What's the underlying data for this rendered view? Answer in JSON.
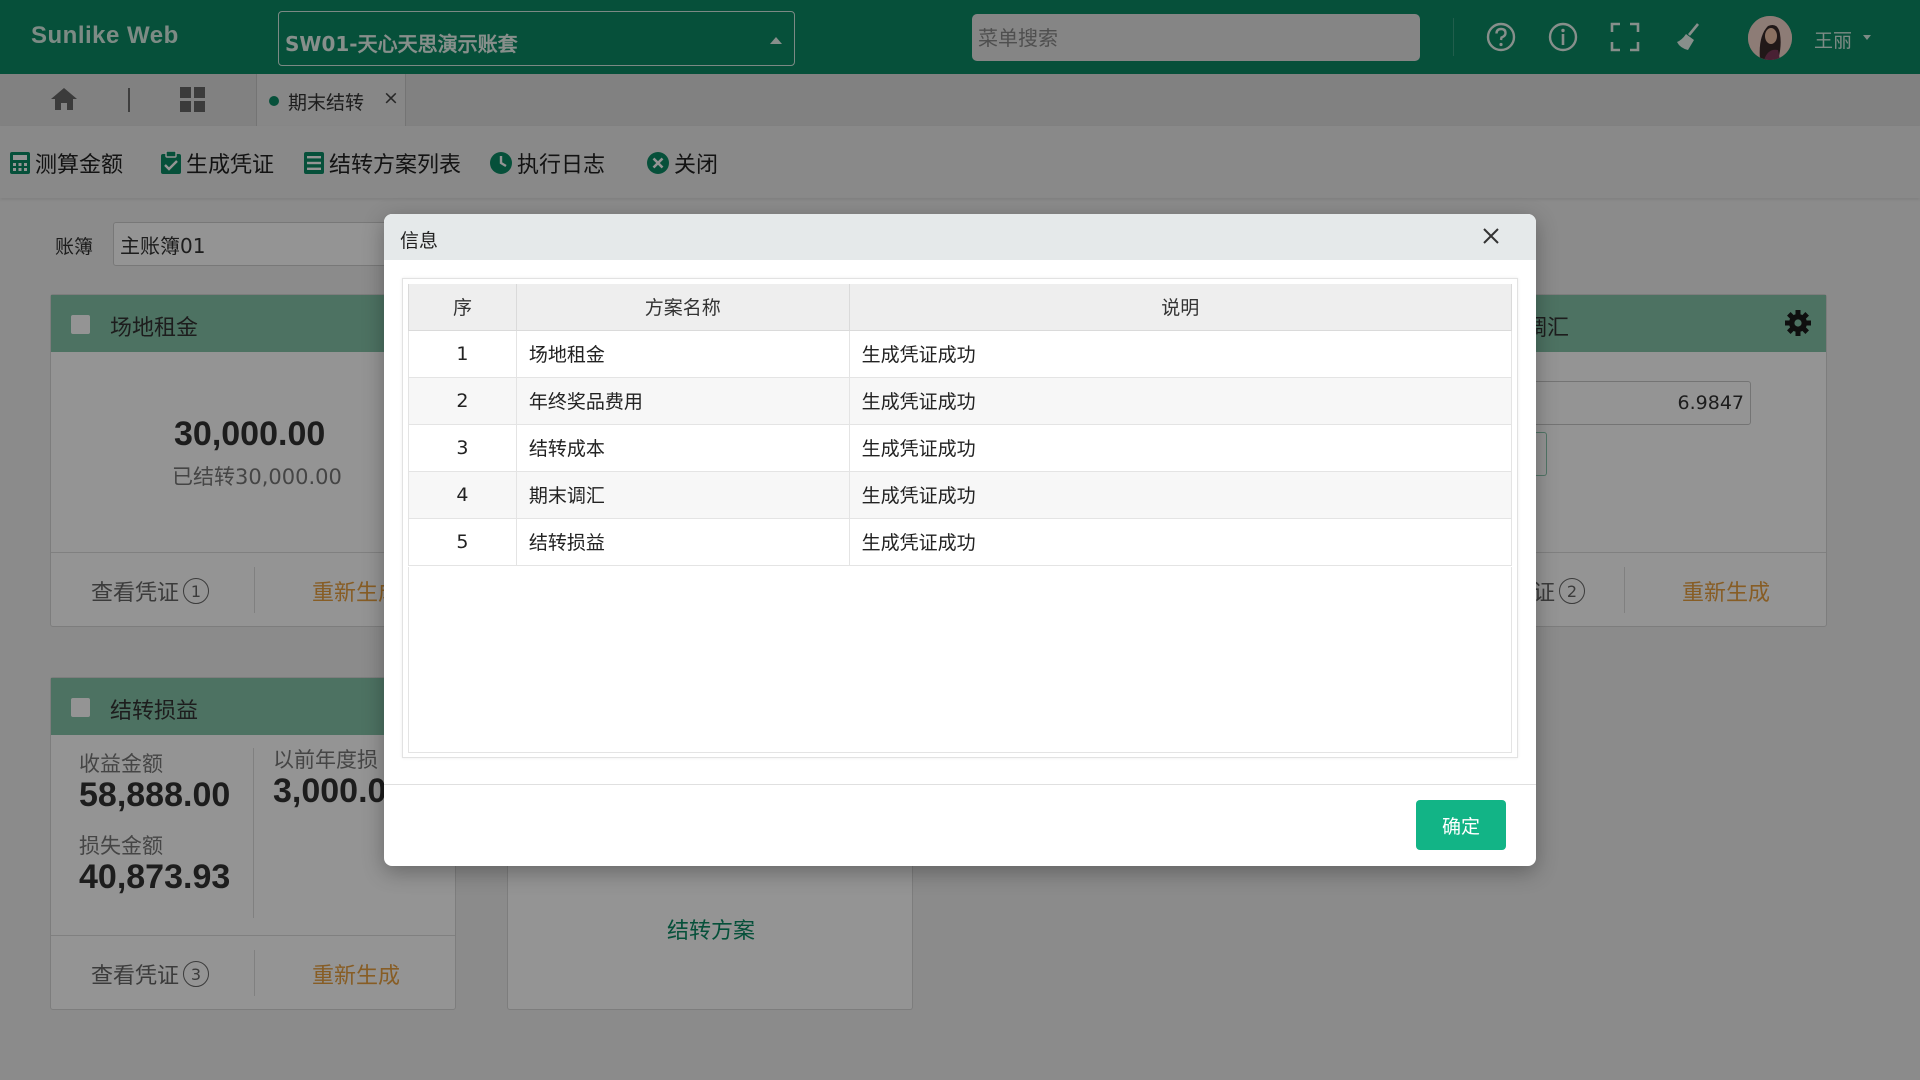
{
  "topbar": {
    "brand": "Sunlike Web",
    "account": "SW01-天心天思演示账套",
    "search_placeholder": "菜单搜索",
    "icons": [
      "help-icon",
      "info-icon",
      "fullscreen-icon",
      "clean-icon"
    ],
    "username": "王丽"
  },
  "tabs": {
    "active_label": "期末结转",
    "close_glyph": "×"
  },
  "toolbar": {
    "calc": "测算金额",
    "gen_voucher": "生成凭证",
    "scheme_list": "结转方案列表",
    "exec_log": "执行日志",
    "close": "关闭"
  },
  "page": {
    "ledger_label": "账簿",
    "ledger_value": "主账簿01",
    "cards": {
      "rent": {
        "title": "场地租金",
        "amount": "30,000.00",
        "carried": "已结转30,000.00",
        "view_voucher": "查看凭证",
        "voucher_count": "1",
        "regen": "重新生成"
      },
      "fx": {
        "title_partial": "调汇",
        "rate": "6.9847",
        "view_voucher_partial": "证",
        "voucher_count": "2",
        "regen": "重新生成"
      },
      "pl": {
        "title": "结转损益",
        "income_label": "收益金额",
        "income": "58,888.00",
        "loss_label": "损失金额",
        "loss": "40,873.93",
        "prior_label": "以前年度损",
        "prior_amount": "3,000.0",
        "view_voucher": "查看凭证",
        "voucher_count": "3",
        "regen": "重新生成"
      },
      "scheme": {
        "link": "结转方案"
      }
    }
  },
  "dialog": {
    "title": "信息",
    "columns": [
      "序",
      "方案名称",
      "说明"
    ],
    "rows": [
      {
        "idx": "1",
        "name": "场地租金",
        "desc": "生成凭证成功"
      },
      {
        "idx": "2",
        "name": "年终奖品费用",
        "desc": "生成凭证成功"
      },
      {
        "idx": "3",
        "name": "结转成本",
        "desc": "生成凭证成功"
      },
      {
        "idx": "4",
        "name": "期末调汇",
        "desc": "生成凭证成功"
      },
      {
        "idx": "5",
        "name": "结转损益",
        "desc": "生成凭证成功"
      }
    ],
    "ok_label": "确定"
  }
}
